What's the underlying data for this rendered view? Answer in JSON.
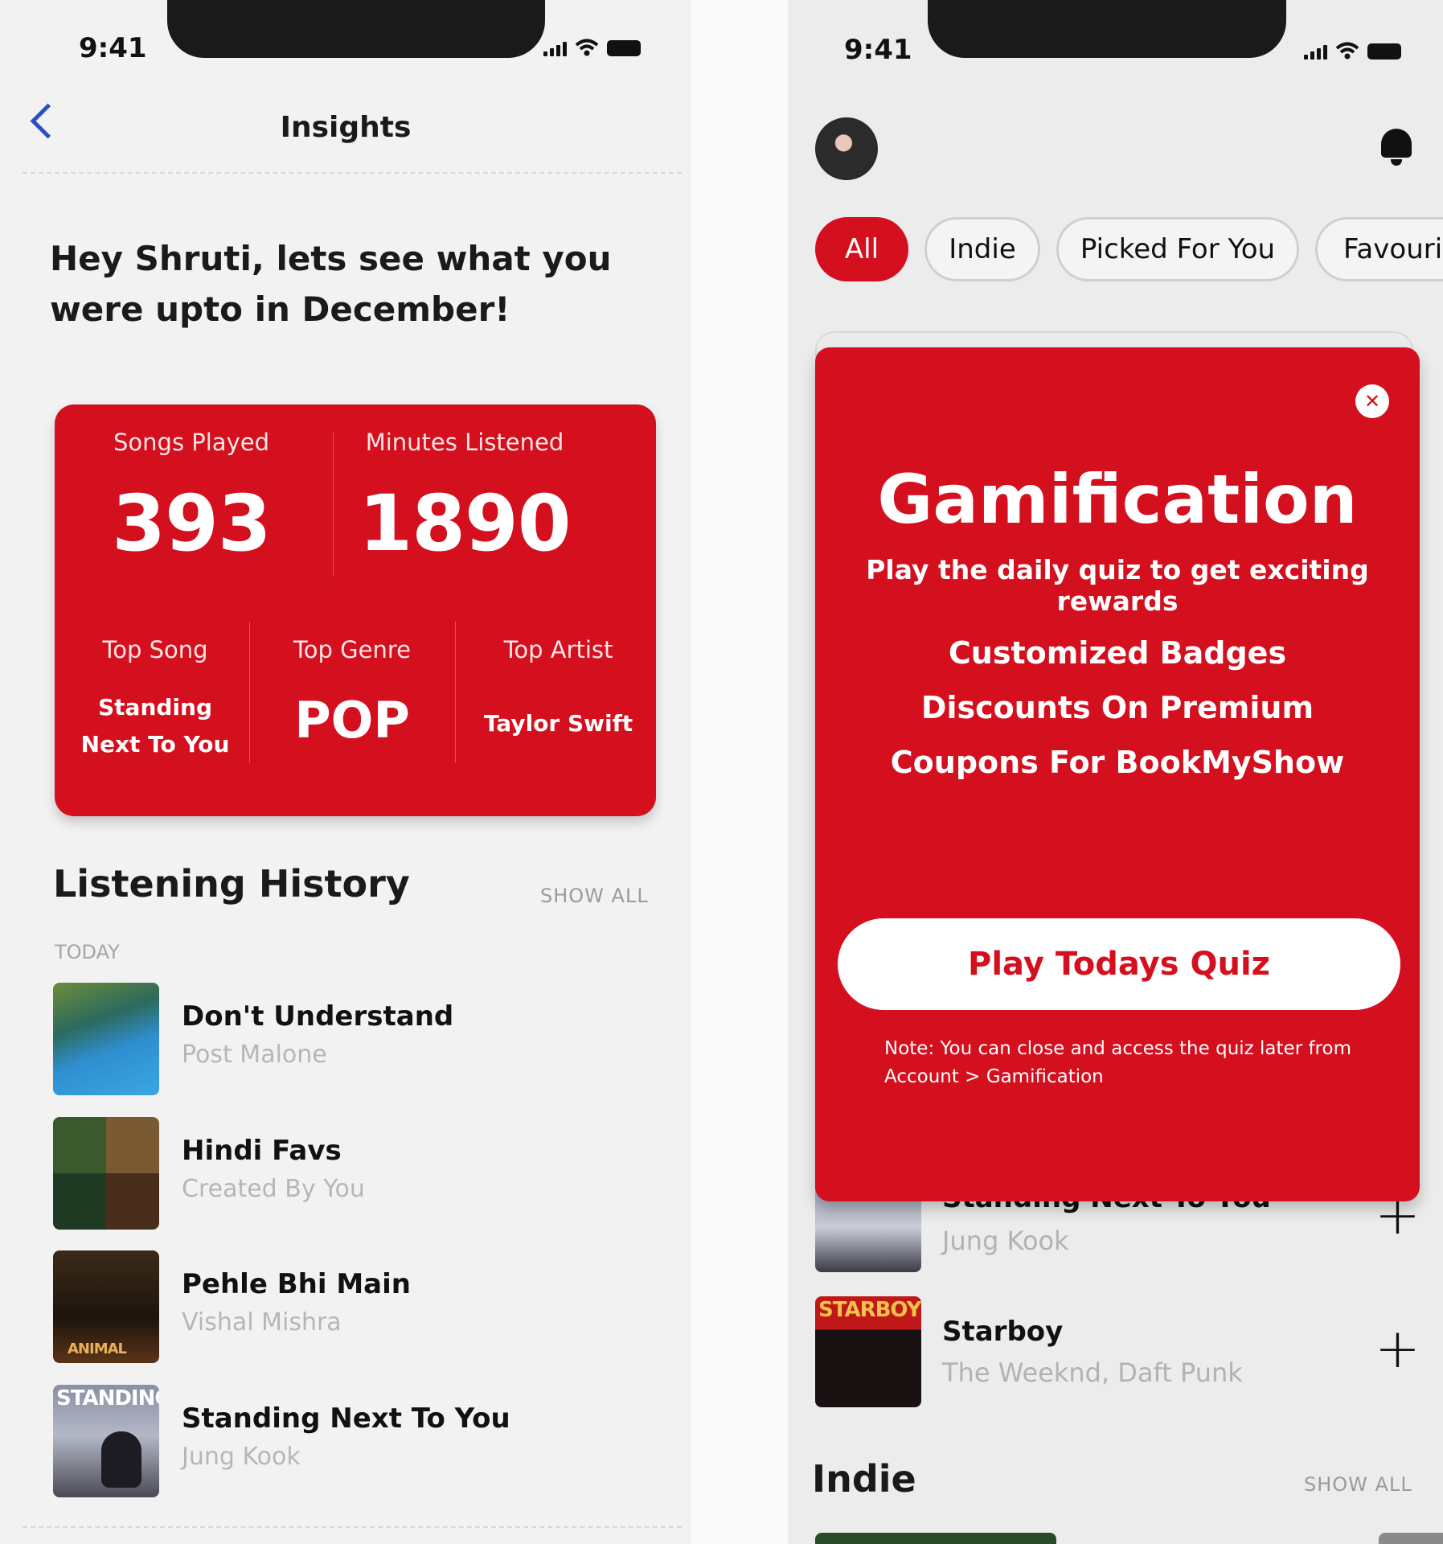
{
  "left_screen": {
    "status_time": "9:41",
    "page_title": "Insights",
    "greeting": "Hey Shruti, lets see what you were upto in December!",
    "stats": {
      "songs_played_label": "Songs Played",
      "songs_played_value": "393",
      "minutes_label": "Minutes Listened",
      "minutes_value": "1890",
      "top_song_label": "Top Song",
      "top_song_line1": "Standing",
      "top_song_line2": "Next To You",
      "top_genre_label": "Top Genre",
      "top_genre_value": "POP",
      "top_artist_label": "Top Artist",
      "top_artist_value": "Taylor Swift"
    },
    "history": {
      "title": "Listening History",
      "show_all": "SHOW ALL",
      "group_label": "TODAY",
      "items": [
        {
          "title": "Don't Understand",
          "subtitle": "Post Malone"
        },
        {
          "title": "Hindi Favs",
          "subtitle": "Created By You"
        },
        {
          "title": "Pehle Bhi Main",
          "subtitle": "Vishal Mishra",
          "art_text": "ANIMAL"
        },
        {
          "title": "Standing Next To You",
          "subtitle": "Jung Kook",
          "art_text": "STANDING"
        }
      ]
    }
  },
  "right_screen": {
    "status_time": "9:41",
    "chips": [
      {
        "label": "All",
        "active": true
      },
      {
        "label": "Indie",
        "active": false
      },
      {
        "label": "Picked For You",
        "active": false
      },
      {
        "label": "Favourit",
        "active": false
      }
    ],
    "modal": {
      "title": "Gamification",
      "subtitle": "Play the daily quiz to get exciting rewards",
      "perks": [
        "Customized Badges",
        "Discounts On Premium",
        "Coupons For BookMyShow"
      ],
      "button": "Play Todays Quiz",
      "note": "Note: You can close and access the quiz later from Account > Gamification"
    },
    "list": [
      {
        "title": "Standing Next To You",
        "subtitle": "Jung Kook"
      },
      {
        "title": "Starboy",
        "subtitle": "The Weeknd, Daft Punk",
        "art_text": "STARBOY"
      }
    ],
    "section_title": "Indie",
    "show_all": "SHOW ALL"
  },
  "colors": {
    "accent": "#d40f1e",
    "back_arrow": "#2a4fc0",
    "muted_text": "#b6b6b6"
  },
  "icons": [
    "back-chevron-icon",
    "signal-icon",
    "wifi-icon",
    "battery-icon",
    "bell-icon",
    "close-icon",
    "plus-icon"
  ]
}
